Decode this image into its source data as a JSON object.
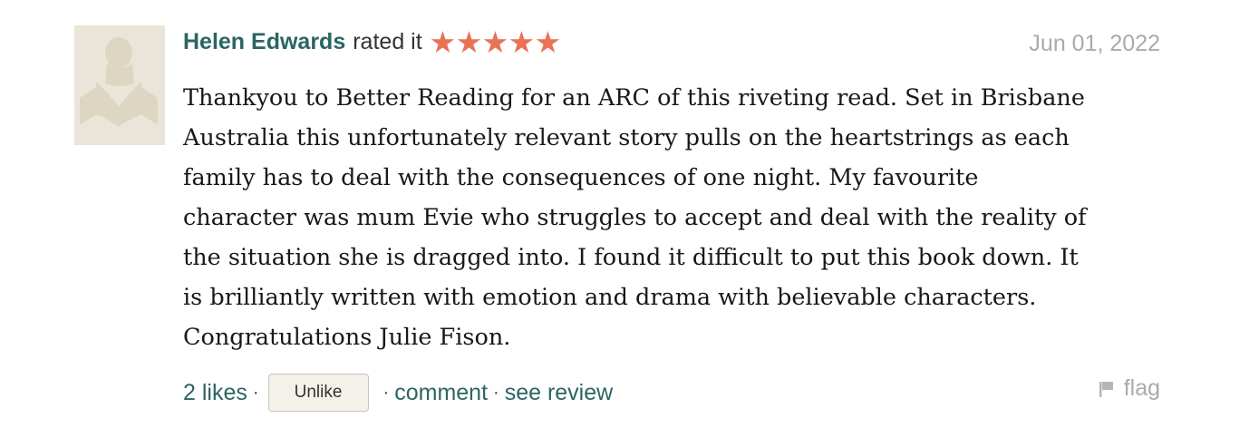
{
  "review": {
    "author": "Helen Edwards",
    "rated_text": "rated it",
    "rating": 5,
    "rating_max": 5,
    "star_color": "#e87356",
    "date": "Jun 01, 2022",
    "lines": [
      "Thankyou to Better Reading for an ARC of this riveting read. Set in Brisbane",
      "Australia this unfortunately relevant story pulls on the heartstrings as each",
      "family has to deal with the consequences of one night. My favourite",
      "character was mum Evie who struggles to accept and deal with the reality of",
      "the situation she is dragged into. I found it difficult to put this book down. It",
      "is brilliantly written with emotion and drama with believable characters.",
      "Congratulations Julie Fison."
    ]
  },
  "footer": {
    "likes": "2 likes",
    "unlike_label": "Unlike",
    "comment": "comment",
    "see_review": "see review",
    "flag": "flag",
    "separator": "·"
  },
  "icons": {
    "avatar": "reader-placeholder-icon",
    "star": "star-icon",
    "flag": "flag-icon"
  },
  "colors": {
    "link": "#2b6563",
    "muted": "#aaaaaa",
    "avatar_bg": "#e9e6d9"
  }
}
